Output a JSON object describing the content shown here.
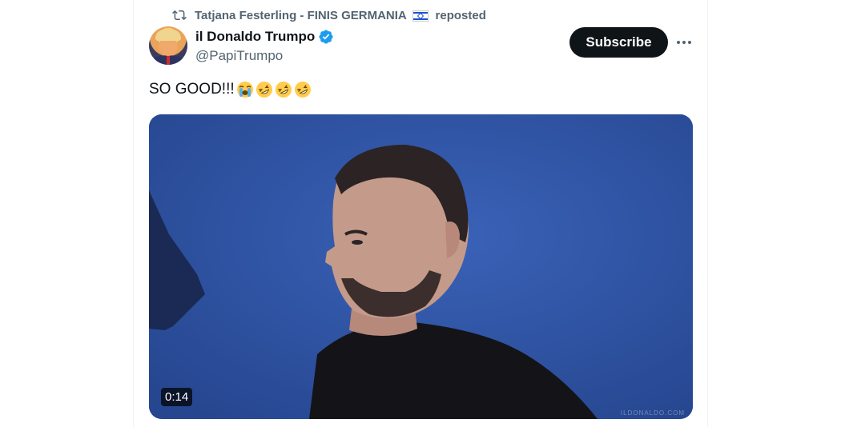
{
  "repost": {
    "reposter": "Tatjana Festerling - FINIS GERMANIA",
    "action": "reposted"
  },
  "author": {
    "name": "il Donaldo Trumpo",
    "handle": "@PapiTrumpo",
    "verified": true
  },
  "actions": {
    "subscribe_label": "Subscribe"
  },
  "tweet": {
    "text": "SO GOOD!!!",
    "emojis": [
      "loudly-crying-face",
      "rolling-on-floor-laughing",
      "rolling-on-floor-laughing",
      "rolling-on-floor-laughing"
    ]
  },
  "media": {
    "type": "video",
    "duration": "0:14",
    "watermark": "ILDONALDO.COM"
  },
  "colors": {
    "primary_text": "#0f1419",
    "secondary_text": "#536471",
    "verified_blue": "#1d9bf0",
    "button_bg": "#0f1419",
    "video_background": "#2d4f9e"
  }
}
